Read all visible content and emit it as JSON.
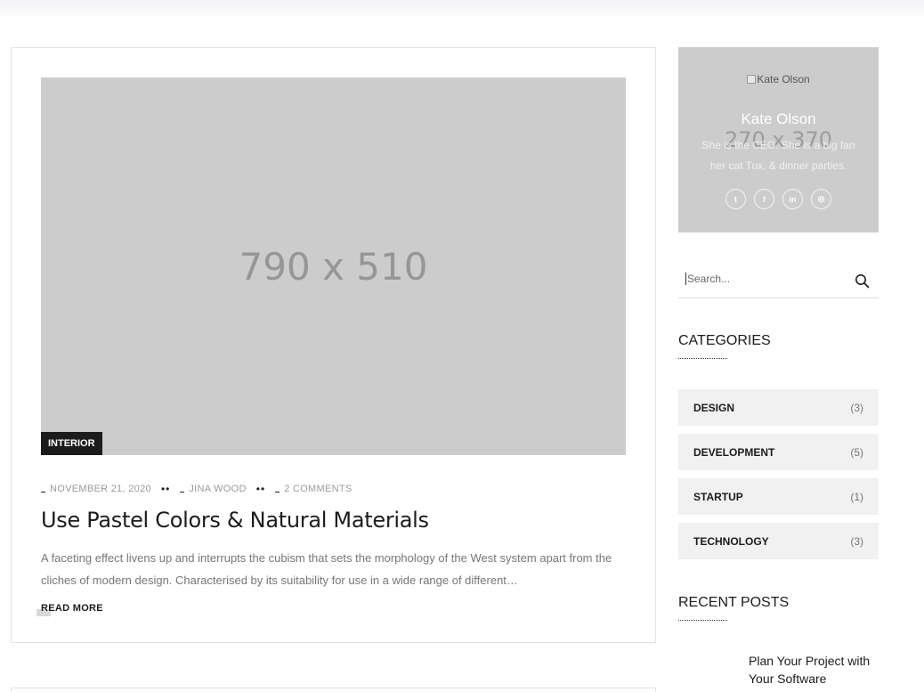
{
  "post": {
    "image_placeholder": "790 x 510",
    "category": "INTERIOR",
    "date": "NOVEMBER 21, 2020",
    "author": "JINA WOOD",
    "comments": "2 COMMENTS",
    "separator": "••",
    "title": "Use Pastel Colors & Natural Materials",
    "excerpt": "A faceting effect livens up and interrupts the cubism that sets the morphology of the West system apart from the cliches of modern design. Characterised by its suitability for use in a wide range of different…",
    "read_more": "READ MORE"
  },
  "author_box": {
    "image_alt": "Kate Olson",
    "image_placeholder": "270 x 370",
    "name": "Kate Olson",
    "bio": "She is the CEO. She is a big fan her cat Tux, & dinner parties.",
    "socials": [
      {
        "icon": "twitter-icon",
        "glyph": "t"
      },
      {
        "icon": "facebook-icon",
        "glyph": "f"
      },
      {
        "icon": "linkedin-icon",
        "glyph": "in"
      },
      {
        "icon": "instagram-icon",
        "glyph": "◎"
      }
    ]
  },
  "search": {
    "placeholder": "Search..."
  },
  "categories": {
    "title": "CATEGORIES",
    "items": [
      {
        "name": "DESIGN",
        "count": "(3)"
      },
      {
        "name": "DEVELOPMENT",
        "count": "(5)"
      },
      {
        "name": "STARTUP",
        "count": "(1)"
      },
      {
        "name": "TECHNOLOGY",
        "count": "(3)"
      }
    ]
  },
  "recent_posts": {
    "title": "RECENT POSTS",
    "items": [
      {
        "title": "Plan Your Project with Your Software"
      }
    ]
  }
}
